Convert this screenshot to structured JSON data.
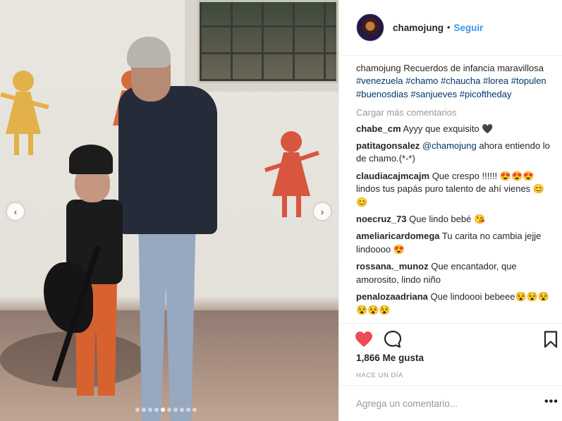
{
  "header": {
    "username": "chamojung",
    "separator": "•",
    "follow_label": "Seguir"
  },
  "caption": {
    "username": "chamojung",
    "text": "Recuerdos de infancia maravillosa",
    "hashtags": [
      "#venezuela",
      "#chamo",
      "#chaucha",
      "#lorea",
      "#topulen",
      "#buenosdias",
      "#sanjueves",
      "#picoftheday"
    ]
  },
  "load_more_label": "Cargar más comentarios",
  "comments": [
    {
      "user": "chabe_cm",
      "text": "Ayyy que exquisito 🖤"
    },
    {
      "user": "patitagonsalez",
      "mention": "@chamojung",
      "text": "ahora entiendo lo de chamo.(*-*)"
    },
    {
      "user": "claudiacajmcajm",
      "text": "Que crespo !!!!!! 😍😍😍 lindos tus papás puro talento de ahí vienes 😊😊"
    },
    {
      "user": "noecruz_73",
      "text": "Que lindo bebé 😘"
    },
    {
      "user": "ameliaricardomega",
      "text": "Tu carita no cambia jejje lindoooo 😍"
    },
    {
      "user": "rossana._munoz",
      "text": "Que encantador, que amorosito, lindo niño"
    },
    {
      "user": "penalozaadriana",
      "text": "Que lindoooi bebeee😵😵😵😵😵😵"
    }
  ],
  "likes": "1,866 Me gusta",
  "timestamp": "HACE UN DÍA",
  "add_comment": {
    "placeholder": "Agrega un comentario..."
  },
  "more_label": "•••",
  "carousel": {
    "prev": "‹",
    "next": "›",
    "total": 10,
    "active_index": 4
  },
  "icons": {
    "heart": "heart-icon",
    "comment": "comment-icon",
    "bookmark": "bookmark-icon",
    "prev": "chevron-left-icon",
    "next": "chevron-right-icon"
  },
  "colors": {
    "accent": "#3897f0",
    "hashtag": "#003569",
    "like": "#ed4956",
    "muted": "#999999"
  }
}
